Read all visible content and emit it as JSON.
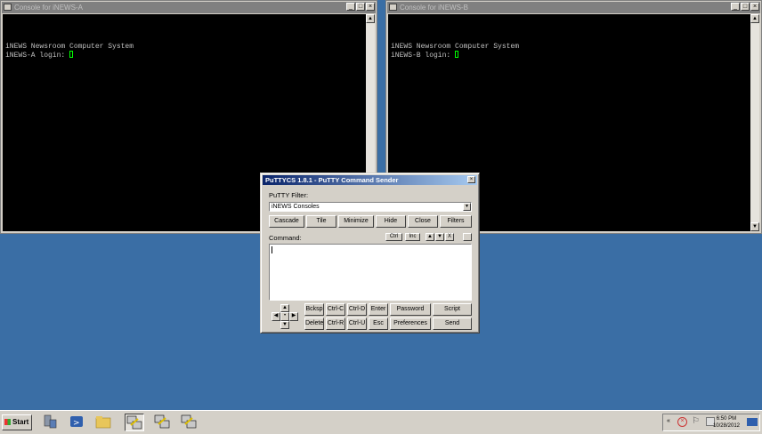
{
  "colors": {
    "desktop": "#3a6ea5",
    "terminal_bg": "#000000",
    "terminal_text": "#c0c0c0",
    "cursor": "#00ff00",
    "dialog_title": "#0a246a"
  },
  "console_a": {
    "title": "Console for iNEWS-A",
    "lines": [
      "iNEWS Newsroom Computer System",
      "iNEWS-A login: "
    ],
    "controls": [
      "_",
      "□",
      "×"
    ]
  },
  "console_b": {
    "title": "Console for iNEWS-B",
    "lines": [
      "iNEWS Newsroom Computer System",
      "iNEWS-B login: "
    ],
    "controls": [
      "_",
      "□",
      "×"
    ]
  },
  "dialog": {
    "title": "PuTTYCS 1.8.1 - PuTTY Command Sender",
    "filter_label": "PuTTY Filter:",
    "filter_value": "iNEWS Consoles",
    "window_buttons": [
      "Cascade",
      "Tile",
      "Minimize",
      "Hide",
      "Close",
      "Filters"
    ],
    "command_label": "Command:",
    "ctrl_label": "Ctrl",
    "inc_label": "Inc",
    "small_buttons": [
      "▲",
      "▼",
      "X"
    ],
    "bottom_row1": [
      "Bcksp",
      "Ctrl-C",
      "Ctrl-D",
      "Enter",
      "Password",
      "Script"
    ],
    "bottom_row2": [
      "Delete",
      "Ctrl-R",
      "Ctrl-U",
      "Esc",
      "Preferences",
      "Send"
    ],
    "close": "×"
  },
  "taskbar": {
    "start_label": "Start",
    "clock_time": "6:50 PM",
    "clock_date": "10/28/2012",
    "icons": [
      "server-manager-icon",
      "powershell-icon",
      "explorer-icon",
      "putty-icon",
      "putty-icon",
      "putty-icon"
    ]
  }
}
